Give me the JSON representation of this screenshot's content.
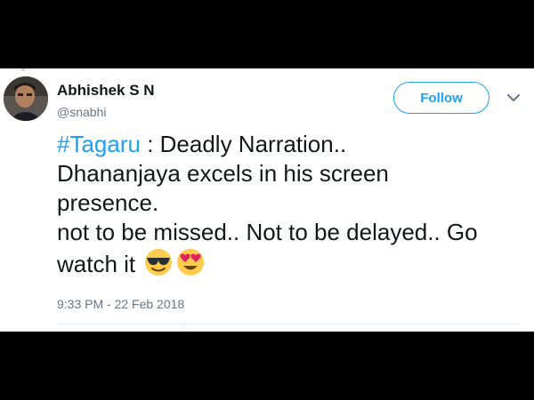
{
  "tweet": {
    "display_name": "Abhishek S N",
    "handle": "@snabhi",
    "follow_label": "Follow",
    "hashtag": "#Tagaru",
    "line1_rest": " : Deadly Narration..",
    "line2": "Dhananjaya excels in his screen",
    "line3": "presence.",
    "line4": "not to be missed.. Not to be delayed.. Go",
    "line5": "watch it",
    "emojis": [
      "smiling-face-with-sunglasses",
      "smiling-face-with-heart-eyes"
    ],
    "timestamp": "9:33 PM - 22 Feb 2018"
  },
  "colors": {
    "accent": "#1da1f2",
    "text": "#14171a",
    "muted": "#657786",
    "border": "#e6ecf0",
    "emoji_yellow": "#ffcc4d",
    "heart": "#e0245e"
  }
}
